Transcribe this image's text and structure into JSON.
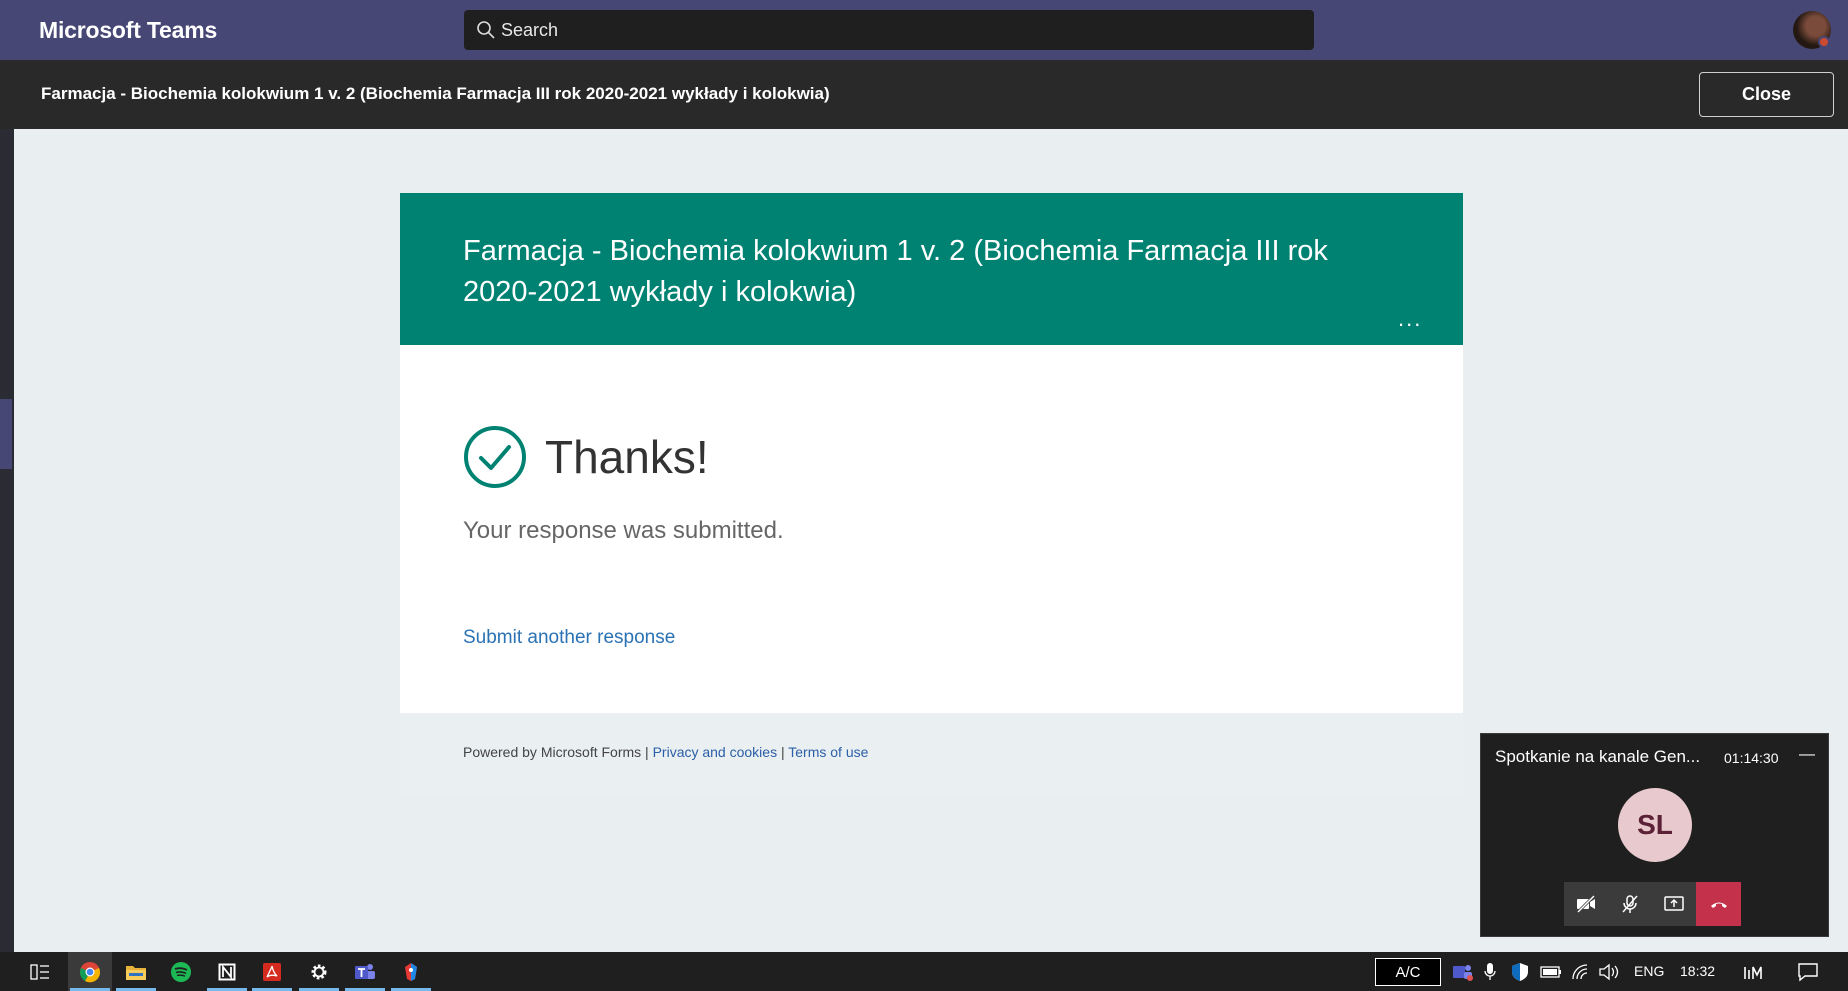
{
  "app": {
    "title": "Microsoft Teams"
  },
  "search": {
    "label": "Search"
  },
  "stage": {
    "title": "Farmacja - Biochemia kolokwium 1 v. 2 (Biochemia Farmacja III rok 2020-2021 wykłady i kolokwia)",
    "close_label": "Close"
  },
  "form": {
    "title": "Farmacja - Biochemia kolokwium 1 v. 2 (Biochemia Farmacja III rok 2020-2021 wykłady i kolokwia)",
    "more_label": "...",
    "thanks": "Thanks!",
    "submitted": "Your response was submitted.",
    "another_link": "Submit another response",
    "footer": {
      "powered": "Powered by Microsoft Forms | ",
      "privacy": "Privacy and cookies",
      "sep": " | ",
      "terms": "Terms of use"
    },
    "accent": "#008272"
  },
  "meeting": {
    "title": "Spotkanie na kanale Gen...",
    "time": "01:14:30",
    "minimize": "—",
    "initials": "SL"
  },
  "taskbar": {
    "apps": [
      "task-view",
      "chrome",
      "file-explorer",
      "spotify",
      "notion",
      "acrobat",
      "settings",
      "teams",
      "app"
    ],
    "ac_label": "A/C",
    "lang": "ENG",
    "clock": "18:32"
  },
  "colors": {
    "teams_bar": "#464775",
    "hangup": "#c4314b",
    "link": "#2b72b4"
  }
}
